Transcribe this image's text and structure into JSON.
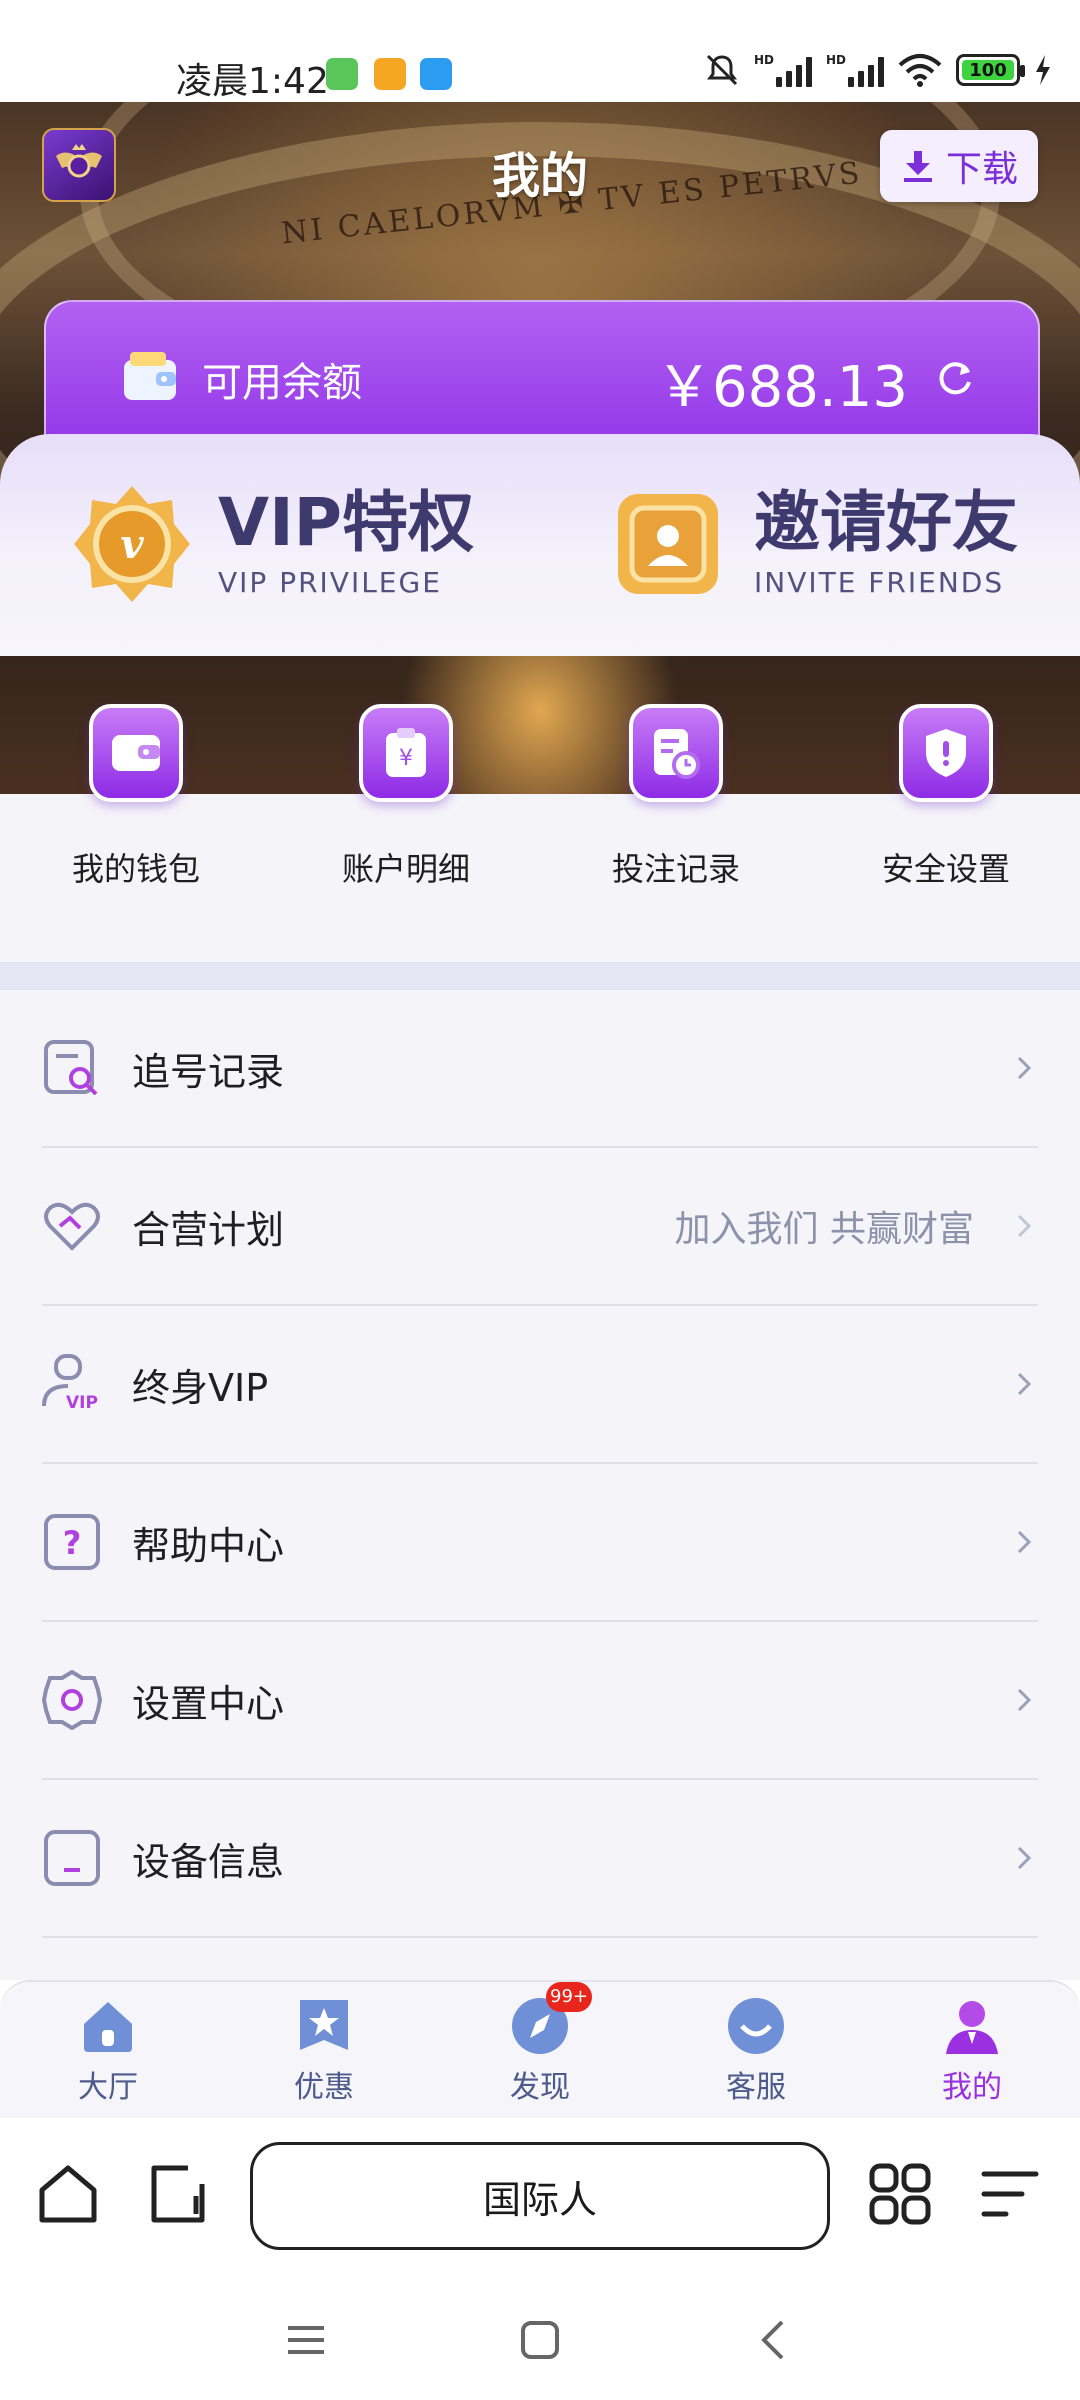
{
  "status_bar": {
    "time": "凌晨1:42",
    "signal1_label": "HD",
    "signal2_label": "HD",
    "battery": "100"
  },
  "header": {
    "title": "我的",
    "download_label": "下载",
    "background_inscription": "NI CAELORVM ✠ TV ES PETRVS"
  },
  "balance": {
    "label": "可用余额",
    "amount": "￥688.13"
  },
  "privileges": [
    {
      "title": "VIP特权",
      "subtitle": "VIP PRIVILEGE"
    },
    {
      "title": "邀请好友",
      "subtitle": "INVITE FRIENDS"
    }
  ],
  "quick_actions": [
    {
      "label": "我的钱包",
      "icon": "wallet-icon"
    },
    {
      "label": "账户明细",
      "icon": "yuan-clipboard-icon"
    },
    {
      "label": "投注记录",
      "icon": "bet-record-icon"
    },
    {
      "label": "安全设置",
      "icon": "shield-icon"
    }
  ],
  "menu": [
    {
      "label": "追号记录",
      "extra": "",
      "icon": "search-record-icon"
    },
    {
      "label": "合营计划",
      "extra": "加入我们 共赢财富",
      "icon": "heart-handshake-icon"
    },
    {
      "label": "终身VIP",
      "extra": "",
      "icon": "vip-user-icon"
    },
    {
      "label": "帮助中心",
      "extra": "",
      "icon": "question-icon"
    },
    {
      "label": "设置中心",
      "extra": "",
      "icon": "gear-icon"
    },
    {
      "label": "设备信息",
      "extra": "",
      "icon": "device-icon"
    }
  ],
  "tabs": [
    {
      "label": "大厅",
      "icon": "home-icon"
    },
    {
      "label": "优惠",
      "icon": "star-icon"
    },
    {
      "label": "发现",
      "icon": "compass-icon",
      "badge": "99+"
    },
    {
      "label": "客服",
      "icon": "chat-icon"
    },
    {
      "label": "我的",
      "icon": "user-icon",
      "active": true
    }
  ],
  "browser": {
    "url_text": "国际人"
  },
  "colors": {
    "accent": "#9a30e0",
    "balance_card": "#8c2ee6",
    "menu_bg": "#f4f4f9"
  }
}
